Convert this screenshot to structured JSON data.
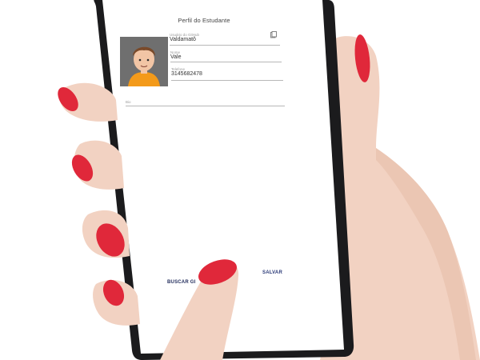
{
  "profile": {
    "title": "Perfil do Estudante",
    "fields": [
      {
        "label": "Usuário do GitHub",
        "value": "Valdamatô"
      },
      {
        "label": "Nome",
        "value": "Vale"
      },
      {
        "label": "Telefone",
        "value": "3145682478"
      },
      {
        "label": "Bio",
        "value": ""
      }
    ],
    "buttons": {
      "search": "BUSCAR GI",
      "save": "SALVAR"
    }
  },
  "colors": {
    "nail": "#e0283a",
    "skin": "#f2d2c2",
    "phone_frame": "#1b1b1d",
    "accent_button": "#2b3a78",
    "avatar_shirt": "#f39a1a",
    "avatar_hair": "#7a4a2a"
  },
  "icons": {
    "avatar": "boy-avatar",
    "copy": "copy-icon"
  }
}
